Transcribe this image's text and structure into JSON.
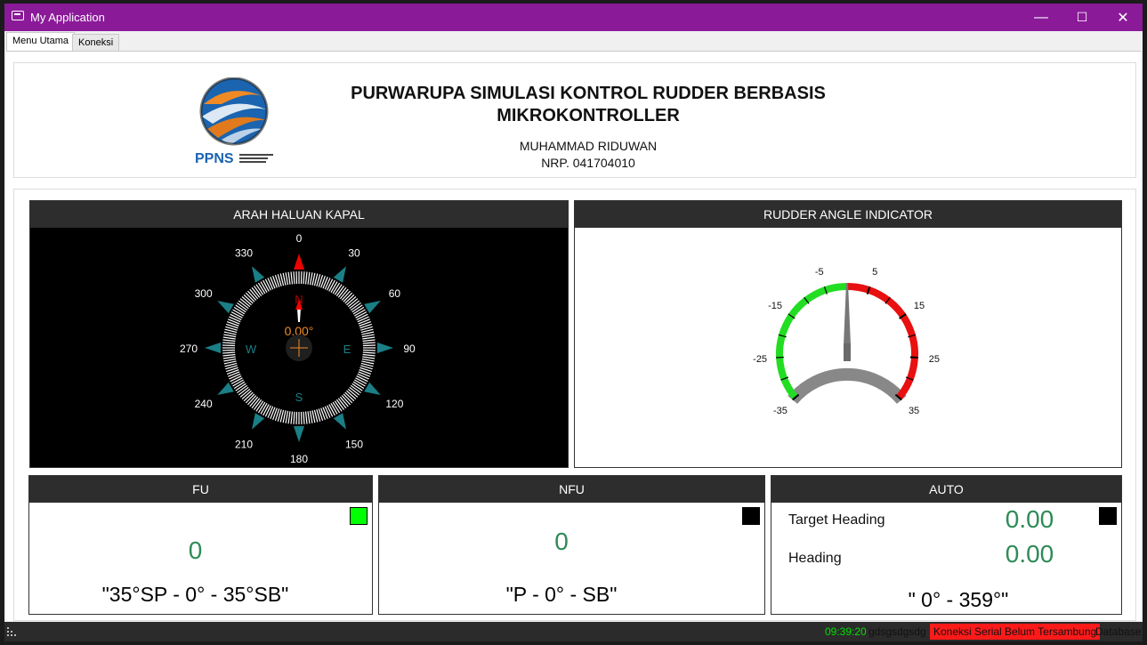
{
  "window": {
    "title": "My Application",
    "minimize": "—",
    "maximize": "☐",
    "close": "✕"
  },
  "tabs": [
    {
      "label": "Menu Utama"
    },
    {
      "label": "Koneksi"
    }
  ],
  "header": {
    "title_line1": "PURWARUPA SIMULASI KONTROL RUDDER BERBASIS",
    "title_line2": "MIKROKONTROLLER",
    "author": "MUHAMMAD RIDUWAN",
    "nrp": "NRP. 041704010",
    "logo_text": "PPNS"
  },
  "compass": {
    "title": "ARAH HALUAN KAPAL",
    "heading": 0,
    "heading_text": "0.00°",
    "degree_labels": [
      "0",
      "30",
      "60",
      "90",
      "120",
      "150",
      "180",
      "210",
      "240",
      "270",
      "300",
      "330"
    ],
    "cardinals": {
      "n": "N",
      "e": "E",
      "s": "S",
      "w": "W"
    }
  },
  "rudder": {
    "title": "RUDDER ANGLE INDICATOR",
    "angle": 0,
    "scale_labels": [
      "-35",
      "-25",
      "-15",
      "-5",
      "5",
      "15",
      "25",
      "35"
    ],
    "port_color": "#22dd22",
    "starboard_color": "#e81010"
  },
  "fu": {
    "title": "FU",
    "value": "0",
    "range": "\"35°SP - 0° - 35°SB\"",
    "indicator_color": "#00ff00"
  },
  "nfu": {
    "title": "NFU",
    "value": "0",
    "range": "\"P - 0° - SB\"",
    "indicator_color": "#000000"
  },
  "auto": {
    "title": "AUTO",
    "target_label": "Target Heading",
    "target_value": "0.00",
    "heading_label": "Heading",
    "heading_value": "0.00",
    "range": "\" 0° - 359°\"",
    "indicator_color": "#000000"
  },
  "status": {
    "time": "09:39:20",
    "text": "gdsgsdgsdg",
    "serial": "Koneksi Serial Belum Tersambung",
    "database": "Database"
  },
  "colors": {
    "titlebar": "#8b1a99",
    "accent_teal": "#1a7f86",
    "value_green": "#2e8b57"
  }
}
